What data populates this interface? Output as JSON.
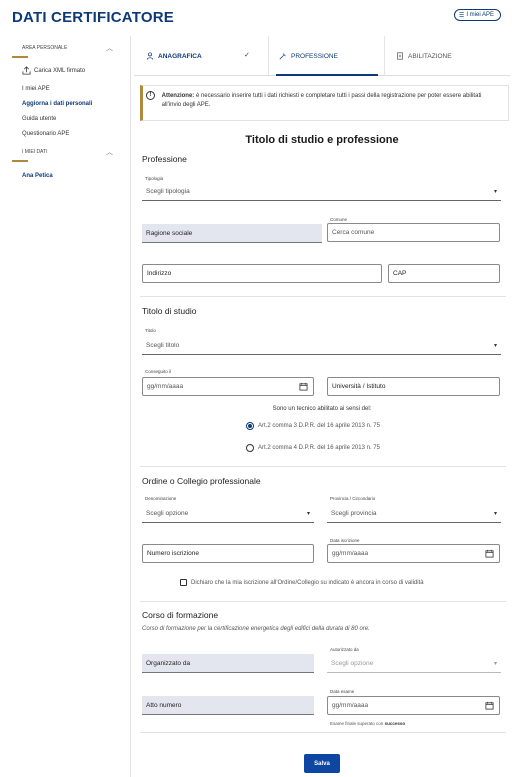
{
  "header": {
    "title": "DATI CERTIFICATORE",
    "my_ape_label": "I miei APE"
  },
  "sidebar": {
    "personal_area": {
      "label": "AREA PERSONALE",
      "upload_label": "Carica XML firmato",
      "items": [
        "I miei APE",
        "Aggiorna i dati personali",
        "Guida utente",
        "Questionario APE"
      ],
      "active_item": "Aggiorna i dati personali"
    },
    "my_data": {
      "label": "I MIEI DATI",
      "user_name": "Ana Petica"
    }
  },
  "tabs": [
    {
      "label": "ANAGRAFICA",
      "completed": true
    },
    {
      "label": "PROFESSIONE",
      "active": true
    },
    {
      "label": "ABILITAZIONE"
    }
  ],
  "alert": {
    "title": "Attenzione:",
    "text": "è necessario inserire tutti i dati richiesti e completare tutti i passi della registrazione per poter essere abilitati all'invio degli APE."
  },
  "form": {
    "title": "Titolo di studio e professione",
    "professione": {
      "heading": "Professione",
      "tipologia_label": "Tipologia",
      "tipologia_value": "Scegli tipologia",
      "ragione_sociale": "Ragione sociale",
      "comune_label": "Comune",
      "comune_placeholder": "Cerca comune",
      "indirizzo": "Indirizzo",
      "cap": "CAP"
    },
    "titolo_studio": {
      "heading": "Titolo di studio",
      "titolo_label": "Titolo",
      "titolo_value": "Scegli titolo",
      "conseguito_label": "Conseguito il",
      "date_placeholder": "gg/mm/aaaa",
      "universita": "Università / Istituto",
      "question": "Sono un tecnico abilitato ai sensi del:",
      "options": [
        {
          "label": "Art.2 comma 3 D.P.R. del 16 aprile 2013 n. 75",
          "selected": true
        },
        {
          "label": "Art.2 comma 4 D.P.R. del 16 aprile 2013 n. 75",
          "selected": false
        }
      ]
    },
    "ordine": {
      "heading": "Ordine o Collegio professionale",
      "denominazione_label": "Denominazione",
      "denominazione_value": "Scegli opzione",
      "provincia_label": "Provincia / Circondario",
      "provincia_value": "Scegli provincia",
      "numero_iscrizione": "Numero iscrizione",
      "data_iscrizione_label": "Data iscrizione",
      "date_placeholder": "gg/mm/aaaa",
      "checkbox_label": "Dichiaro che la mia iscrizione all'Ordine/Collegio su indicato è ancora in corso di validità"
    },
    "corso": {
      "heading": "Corso di formazione",
      "subtitle": "Corso di formazione per la certificazione energetica degli edifici della durata di 80 ore.",
      "organizzato_da": "Organizzato da",
      "autorizzato_label": "Autorizzato da",
      "autorizzato_value": "Scegli opzione",
      "atto_numero": "Atto numero",
      "data_esame_label": "Data esame",
      "date_placeholder": "gg/mm/aaaa",
      "hint_prefix": "Esame finale superato con",
      "hint_bold": "successo"
    },
    "save_label": "Salva"
  },
  "colors": {
    "primary": "#0d3a77",
    "button": "#0d47a1",
    "accent": "#b08a3c",
    "shaded_field": "#e3e6ef"
  }
}
